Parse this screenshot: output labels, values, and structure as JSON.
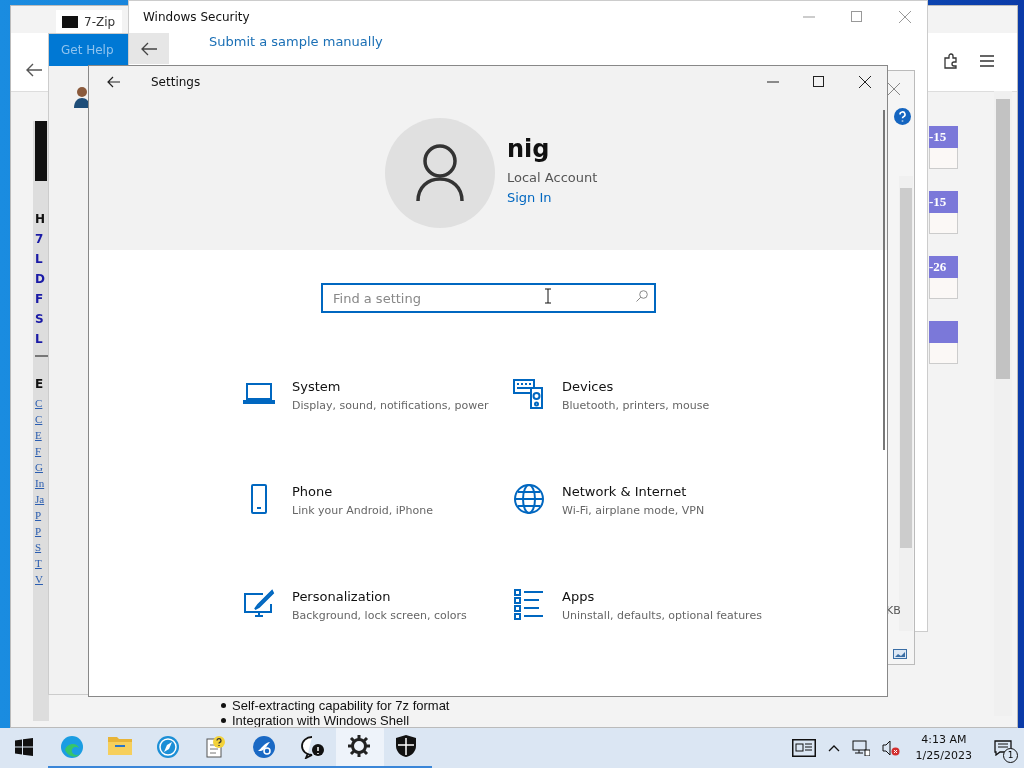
{
  "browser": {
    "tab_title": "7-Zip",
    "sidebar_bold": [
      "H",
      "7",
      "L",
      "D",
      "F",
      "S",
      "L"
    ],
    "sidebar_heading": "E",
    "sidebar_links": [
      "C",
      "C",
      "E",
      "F",
      "G",
      "In",
      "Ja",
      "P",
      "P",
      "S",
      "T",
      "V"
    ],
    "badges": [
      {
        "kind": "text",
        "text": "-15"
      },
      {
        "kind": "text",
        "text": "-15"
      },
      {
        "kind": "text",
        "text": "-26"
      },
      {
        "kind": "blank"
      }
    ],
    "bullets": [
      "Self-extracting capability for 7z format",
      "Integration with Windows Shell"
    ]
  },
  "get_help": {
    "title": "Get Help"
  },
  "security": {
    "title": "Windows Security",
    "link": "Submit a sample manually"
  },
  "file_manager": {
    "size_fragment": "KB"
  },
  "settings": {
    "title": "Settings",
    "user": {
      "name": "nig",
      "account": "Local Account",
      "sign_in": "Sign In"
    },
    "search": {
      "placeholder": "Find a setting"
    },
    "categories": [
      {
        "kind": "laptop",
        "title": "System",
        "description": "Display, sound, notifications, power"
      },
      {
        "kind": "devices",
        "title": "Devices",
        "description": "Bluetooth, printers, mouse"
      },
      {
        "kind": "phone",
        "title": "Phone",
        "description": "Link your Android, iPhone"
      },
      {
        "kind": "globe",
        "title": "Network & Internet",
        "description": "Wi-Fi, airplane mode, VPN"
      },
      {
        "kind": "paint",
        "title": "Personalization",
        "description": "Background, lock screen, colors"
      },
      {
        "kind": "list",
        "title": "Apps",
        "description": "Uninstall, defaults, optional features"
      }
    ]
  },
  "taskbar": {
    "apps": [
      {
        "kind": "start",
        "selected": false,
        "running": false
      },
      {
        "kind": "edge",
        "selected": false,
        "running": true
      },
      {
        "kind": "folder",
        "selected": false,
        "running": true
      },
      {
        "kind": "compass",
        "selected": false,
        "running": true
      },
      {
        "kind": "help",
        "selected": false,
        "running": true
      },
      {
        "kind": "zip",
        "selected": false,
        "running": true
      },
      {
        "kind": "feedback",
        "selected": false,
        "running": true
      },
      {
        "kind": "gear",
        "selected": true,
        "running": true
      },
      {
        "kind": "shield",
        "selected": false,
        "running": true
      }
    ],
    "time": "4:13 AM",
    "date": "1/25/2023",
    "notification_count": "1"
  }
}
